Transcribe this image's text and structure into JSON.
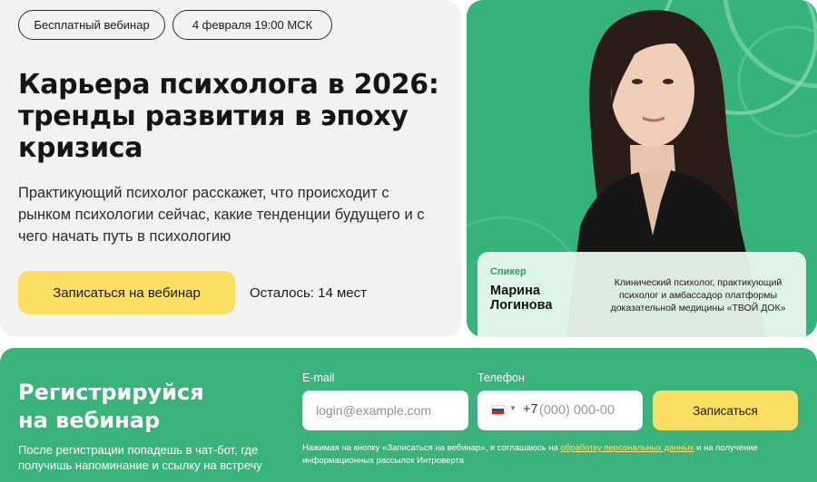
{
  "badges": {
    "webinar": "Бесплатный вебинар",
    "date": "4 февраля 19:00 МСК"
  },
  "hero": {
    "title_lines": [
      "Карьера психолога в 2026:",
      "тренды развития в эпоху",
      "кризиса"
    ],
    "description": "Практикующий психолог расскажет, что происходит с рынком психологии сейчас, какие тенденции будущего и с чего начать путь в психологию",
    "cta_label": "Записаться на вебинар",
    "seats_left": "Осталось: 14 мест"
  },
  "speaker": {
    "label": "Спикер",
    "name_lines": [
      "Марина",
      "Логинова"
    ],
    "role": "Клинический психолог, практикующий психолог и амбассадор платформы доказательной медицины «ТВОЙ ДОК»"
  },
  "registration": {
    "title_lines": [
      "Регистрируйся",
      "на вебинар"
    ],
    "note": "После регистрации попадешь в чат-бот, где получишь напоминание и ссылку на встречу",
    "email_label": "E-mail",
    "email_placeholder": "login@example.com",
    "phone_label": "Телефон",
    "phone_code": "+7",
    "phone_placeholder": "(000) 000-00",
    "submit_label": "Записаться",
    "consent_prefix": "Нажимая на кнопку «Записаться на вебинар», я соглашаюсь на ",
    "consent_link": "обработку персональных данных",
    "consent_suffix": " и на получение информационных рассылок Интроверта"
  },
  "colors": {
    "brand_green": "#39b27b",
    "accent_yellow": "#fbdf63",
    "card_gray": "#f2f2f2"
  }
}
